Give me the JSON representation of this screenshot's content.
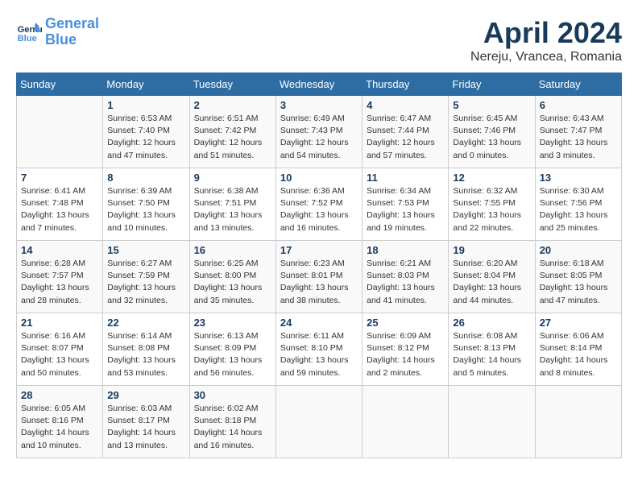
{
  "header": {
    "logo_line1": "General",
    "logo_line2": "Blue",
    "title": "April 2024",
    "subtitle": "Nereju, Vrancea, Romania"
  },
  "weekdays": [
    "Sunday",
    "Monday",
    "Tuesday",
    "Wednesday",
    "Thursday",
    "Friday",
    "Saturday"
  ],
  "weeks": [
    [
      {
        "day": "",
        "info": ""
      },
      {
        "day": "1",
        "info": "Sunrise: 6:53 AM\nSunset: 7:40 PM\nDaylight: 12 hours\nand 47 minutes."
      },
      {
        "day": "2",
        "info": "Sunrise: 6:51 AM\nSunset: 7:42 PM\nDaylight: 12 hours\nand 51 minutes."
      },
      {
        "day": "3",
        "info": "Sunrise: 6:49 AM\nSunset: 7:43 PM\nDaylight: 12 hours\nand 54 minutes."
      },
      {
        "day": "4",
        "info": "Sunrise: 6:47 AM\nSunset: 7:44 PM\nDaylight: 12 hours\nand 57 minutes."
      },
      {
        "day": "5",
        "info": "Sunrise: 6:45 AM\nSunset: 7:46 PM\nDaylight: 13 hours\nand 0 minutes."
      },
      {
        "day": "6",
        "info": "Sunrise: 6:43 AM\nSunset: 7:47 PM\nDaylight: 13 hours\nand 3 minutes."
      }
    ],
    [
      {
        "day": "7",
        "info": "Sunrise: 6:41 AM\nSunset: 7:48 PM\nDaylight: 13 hours\nand 7 minutes."
      },
      {
        "day": "8",
        "info": "Sunrise: 6:39 AM\nSunset: 7:50 PM\nDaylight: 13 hours\nand 10 minutes."
      },
      {
        "day": "9",
        "info": "Sunrise: 6:38 AM\nSunset: 7:51 PM\nDaylight: 13 hours\nand 13 minutes."
      },
      {
        "day": "10",
        "info": "Sunrise: 6:36 AM\nSunset: 7:52 PM\nDaylight: 13 hours\nand 16 minutes."
      },
      {
        "day": "11",
        "info": "Sunrise: 6:34 AM\nSunset: 7:53 PM\nDaylight: 13 hours\nand 19 minutes."
      },
      {
        "day": "12",
        "info": "Sunrise: 6:32 AM\nSunset: 7:55 PM\nDaylight: 13 hours\nand 22 minutes."
      },
      {
        "day": "13",
        "info": "Sunrise: 6:30 AM\nSunset: 7:56 PM\nDaylight: 13 hours\nand 25 minutes."
      }
    ],
    [
      {
        "day": "14",
        "info": "Sunrise: 6:28 AM\nSunset: 7:57 PM\nDaylight: 13 hours\nand 28 minutes."
      },
      {
        "day": "15",
        "info": "Sunrise: 6:27 AM\nSunset: 7:59 PM\nDaylight: 13 hours\nand 32 minutes."
      },
      {
        "day": "16",
        "info": "Sunrise: 6:25 AM\nSunset: 8:00 PM\nDaylight: 13 hours\nand 35 minutes."
      },
      {
        "day": "17",
        "info": "Sunrise: 6:23 AM\nSunset: 8:01 PM\nDaylight: 13 hours\nand 38 minutes."
      },
      {
        "day": "18",
        "info": "Sunrise: 6:21 AM\nSunset: 8:03 PM\nDaylight: 13 hours\nand 41 minutes."
      },
      {
        "day": "19",
        "info": "Sunrise: 6:20 AM\nSunset: 8:04 PM\nDaylight: 13 hours\nand 44 minutes."
      },
      {
        "day": "20",
        "info": "Sunrise: 6:18 AM\nSunset: 8:05 PM\nDaylight: 13 hours\nand 47 minutes."
      }
    ],
    [
      {
        "day": "21",
        "info": "Sunrise: 6:16 AM\nSunset: 8:07 PM\nDaylight: 13 hours\nand 50 minutes."
      },
      {
        "day": "22",
        "info": "Sunrise: 6:14 AM\nSunset: 8:08 PM\nDaylight: 13 hours\nand 53 minutes."
      },
      {
        "day": "23",
        "info": "Sunrise: 6:13 AM\nSunset: 8:09 PM\nDaylight: 13 hours\nand 56 minutes."
      },
      {
        "day": "24",
        "info": "Sunrise: 6:11 AM\nSunset: 8:10 PM\nDaylight: 13 hours\nand 59 minutes."
      },
      {
        "day": "25",
        "info": "Sunrise: 6:09 AM\nSunset: 8:12 PM\nDaylight: 14 hours\nand 2 minutes."
      },
      {
        "day": "26",
        "info": "Sunrise: 6:08 AM\nSunset: 8:13 PM\nDaylight: 14 hours\nand 5 minutes."
      },
      {
        "day": "27",
        "info": "Sunrise: 6:06 AM\nSunset: 8:14 PM\nDaylight: 14 hours\nand 8 minutes."
      }
    ],
    [
      {
        "day": "28",
        "info": "Sunrise: 6:05 AM\nSunset: 8:16 PM\nDaylight: 14 hours\nand 10 minutes."
      },
      {
        "day": "29",
        "info": "Sunrise: 6:03 AM\nSunset: 8:17 PM\nDaylight: 14 hours\nand 13 minutes."
      },
      {
        "day": "30",
        "info": "Sunrise: 6:02 AM\nSunset: 8:18 PM\nDaylight: 14 hours\nand 16 minutes."
      },
      {
        "day": "",
        "info": ""
      },
      {
        "day": "",
        "info": ""
      },
      {
        "day": "",
        "info": ""
      },
      {
        "day": "",
        "info": ""
      }
    ]
  ]
}
